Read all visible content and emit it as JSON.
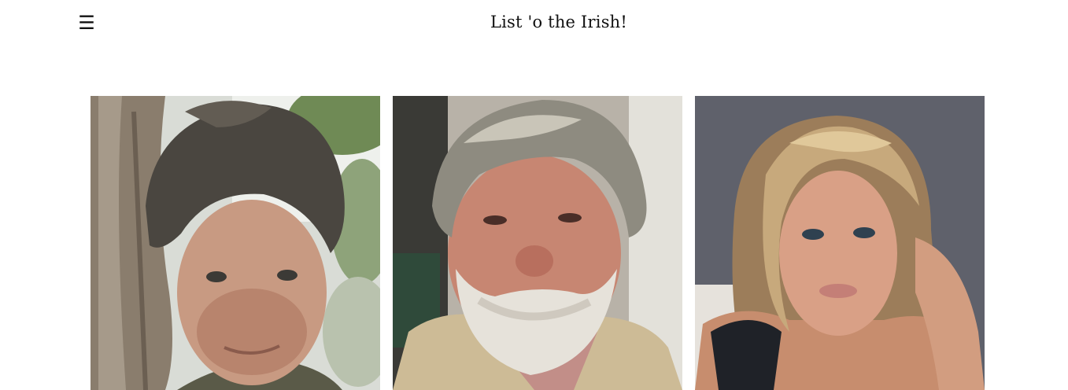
{
  "header": {
    "menu_glyph": "☰",
    "title": "List 'o the Irish!"
  },
  "gallery": {
    "cards": [
      {
        "photo": "portrait-man-dark-hair-tree"
      },
      {
        "photo": "portrait-man-grey-beard"
      },
      {
        "photo": "portrait-woman-blonde"
      }
    ]
  }
}
